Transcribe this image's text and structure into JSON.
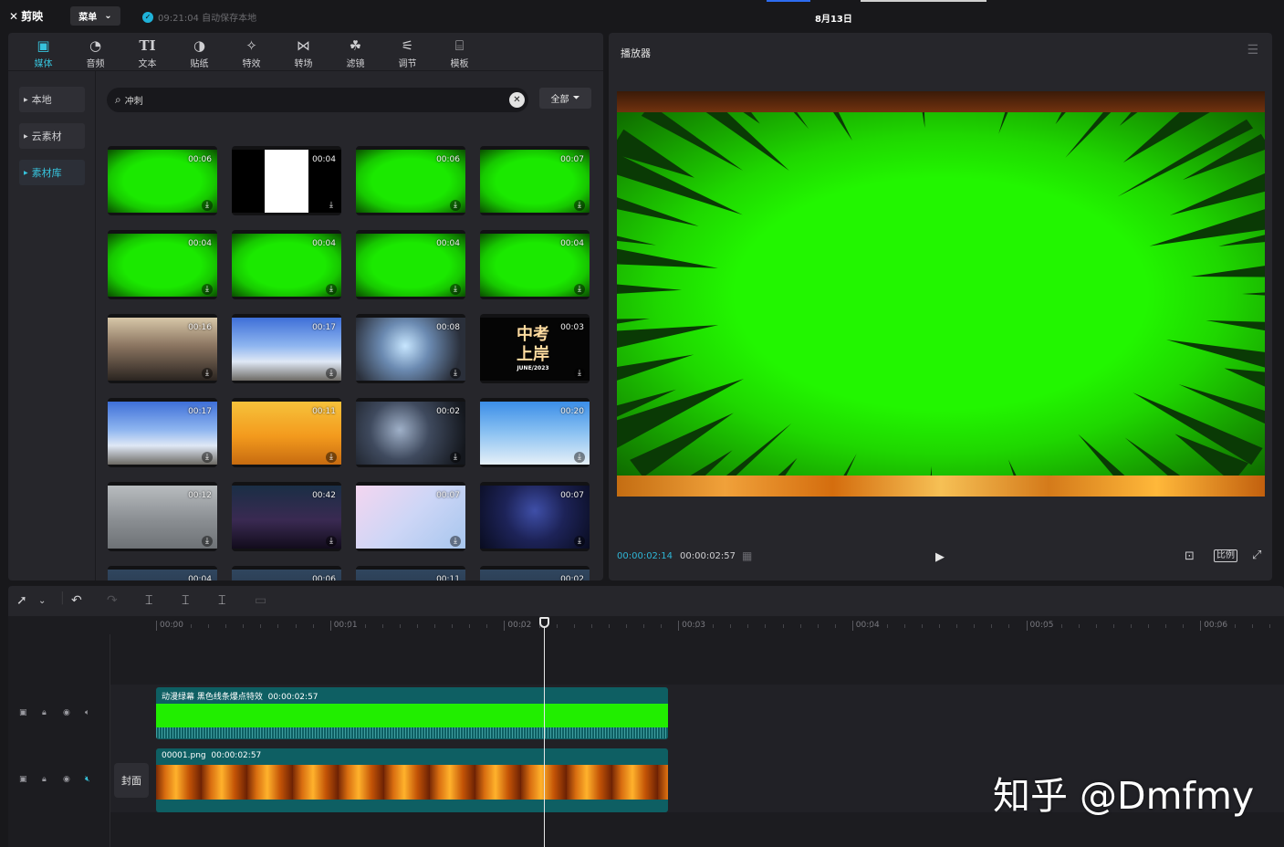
{
  "app": {
    "name": "剪映",
    "menu_label": "菜单",
    "save_status": "09:21:04 自动保存本地",
    "project_date": "8月13日"
  },
  "tabs": [
    {
      "label": "媒体",
      "icon": "media-icon"
    },
    {
      "label": "音频",
      "icon": "audio-icon"
    },
    {
      "label": "文本",
      "icon": "text-icon",
      "glyph": "TI"
    },
    {
      "label": "贴纸",
      "icon": "sticker-icon"
    },
    {
      "label": "特效",
      "icon": "effects-icon"
    },
    {
      "label": "转场",
      "icon": "transition-icon"
    },
    {
      "label": "滤镜",
      "icon": "filter-icon"
    },
    {
      "label": "调节",
      "icon": "adjust-icon"
    },
    {
      "label": "模板",
      "icon": "template-icon"
    }
  ],
  "sidenav": [
    {
      "label": "本地"
    },
    {
      "label": "云素材"
    },
    {
      "label": "素材库"
    }
  ],
  "search": {
    "query": "冲刺",
    "filter_label": "全部"
  },
  "media_grid": [
    {
      "duration": "00:06",
      "kind": "green"
    },
    {
      "duration": "00:04",
      "kind": "bw"
    },
    {
      "duration": "00:06",
      "kind": "green"
    },
    {
      "duration": "00:07",
      "kind": "green"
    },
    {
      "duration": "00:04",
      "kind": "green"
    },
    {
      "duration": "00:04",
      "kind": "green"
    },
    {
      "duration": "00:04",
      "kind": "green"
    },
    {
      "duration": "00:04",
      "kind": "green"
    },
    {
      "duration": "00:16",
      "kind": "city"
    },
    {
      "duration": "00:17",
      "kind": "sky"
    },
    {
      "duration": "00:08",
      "kind": "anime-blue"
    },
    {
      "duration": "00:03",
      "kind": "text",
      "text_line1": "中考",
      "text_line2": "上岸",
      "text_line3": "JUNE/2023"
    },
    {
      "duration": "00:17",
      "kind": "sky"
    },
    {
      "duration": "00:11",
      "kind": "sunset"
    },
    {
      "duration": "00:02",
      "kind": "anime-dark"
    },
    {
      "duration": "00:20",
      "kind": "sky2"
    },
    {
      "duration": "00:12",
      "kind": "gray"
    },
    {
      "duration": "00:42",
      "kind": "night"
    },
    {
      "duration": "00:07",
      "kind": "sakura"
    },
    {
      "duration": "00:07",
      "kind": "dark-blue"
    },
    {
      "duration": "00:04",
      "kind": "partial"
    },
    {
      "duration": "00:06",
      "kind": "partial"
    },
    {
      "duration": "00:11",
      "kind": "partial"
    },
    {
      "duration": "00:02",
      "kind": "partial"
    }
  ],
  "player": {
    "title": "播放器",
    "current_time": "00:00:02:14",
    "total_time": "00:00:02:57",
    "ratio_label": "比例"
  },
  "timeline": {
    "ruler": [
      "|00:00",
      "|00:01",
      "|00:02",
      "|00:03",
      "|00:04",
      "|00:05",
      "|00:06"
    ],
    "cover_label": "封面",
    "clips": [
      {
        "name": "动漫绿幕 黑色线条爆点特效",
        "duration": "00:00:02:57"
      },
      {
        "name": "00001.png",
        "duration": "00:00:02:57"
      }
    ]
  },
  "watermark": "知乎 @Dmfmy",
  "colors": {
    "accent": "#37c3dc",
    "green_screen": "#22f600",
    "clip_bg": "#0e5f63"
  }
}
